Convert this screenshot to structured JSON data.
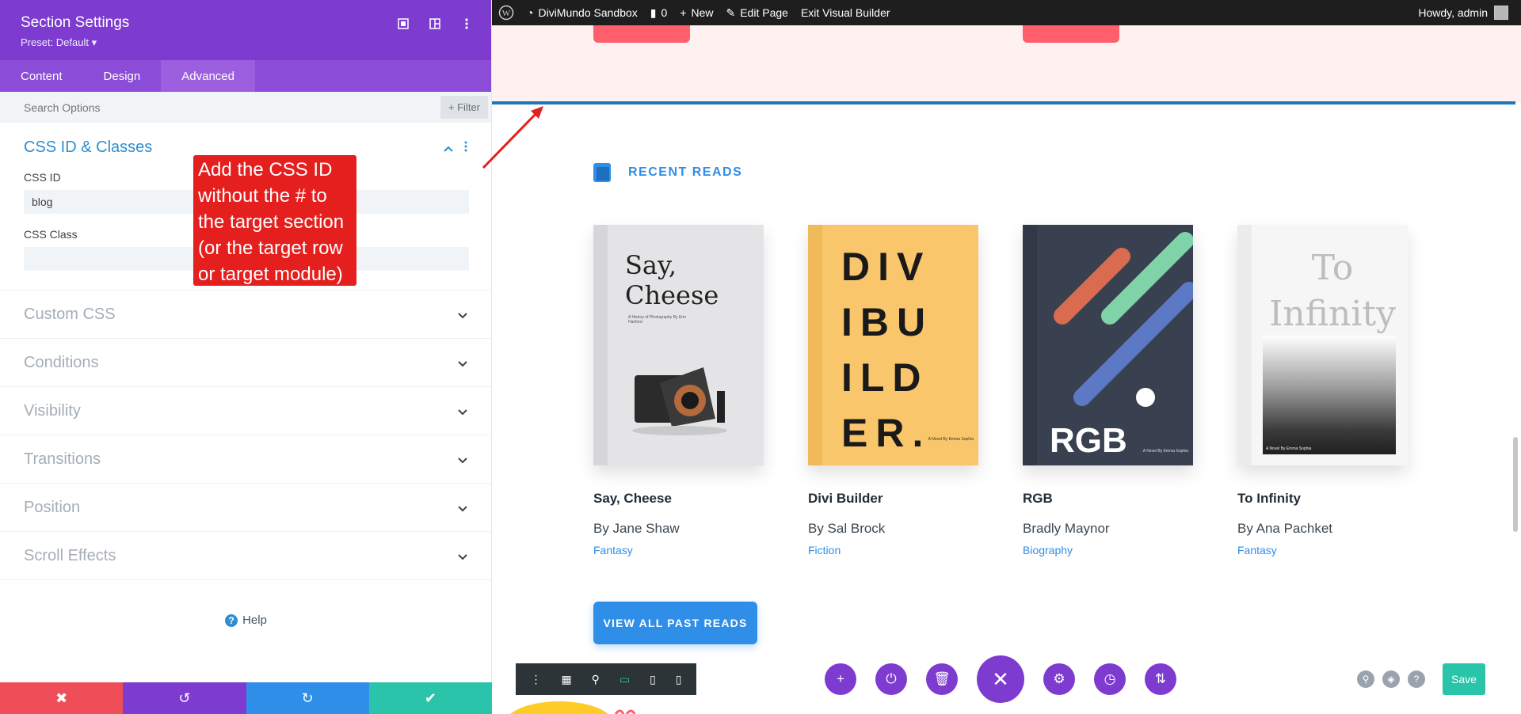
{
  "panel": {
    "title": "Section Settings",
    "preset": "Preset: Default ▾",
    "tabs": [
      "Content",
      "Design",
      "Advanced"
    ],
    "active_tab": "Advanced",
    "search_placeholder": "Search Options",
    "filter_label": "Filter",
    "css_section": {
      "title": "CSS ID & Classes",
      "css_id_label": "CSS ID",
      "css_id_value": "blog",
      "css_class_label": "CSS Class",
      "css_class_value": ""
    },
    "collapsed_sections": [
      "Custom CSS",
      "Conditions",
      "Visibility",
      "Transitions",
      "Position",
      "Scroll Effects"
    ],
    "help_label": "Help",
    "bottom_buttons": [
      "discard",
      "undo",
      "redo",
      "save"
    ],
    "colors": {
      "cancel": "#ef4e58",
      "undo": "#7d3bd0",
      "redo": "#2e8ee8",
      "save": "#29c4a9"
    }
  },
  "annotation": {
    "text": "Add the CSS ID without the # to the target section (or the target row or target module)"
  },
  "admin_bar": {
    "site": "DiviMundo Sandbox",
    "comments": "0",
    "new": "New",
    "edit": "Edit Page",
    "exit": "Exit Visual Builder",
    "greeting": "Howdy, admin"
  },
  "reads": {
    "heading": "RECENT READS",
    "books": [
      {
        "title": "Say, Cheese",
        "author": "By Jane Shaw",
        "genre": "Fantasy",
        "cover_text": "Say, Cheese",
        "cover_small": "A History of Photography By Erin Hanford",
        "cover_color": "#e4e4e6"
      },
      {
        "title": "Divi Builder",
        "author": "By Sal Brock",
        "genre": "Fiction",
        "cover_lines": [
          "DIV",
          "IBU",
          "ILD",
          "ER."
        ],
        "cover_small": "A Novel By Emma Sophia",
        "cover_color": "#f9c66b"
      },
      {
        "title": "RGB",
        "author": "Bradly Maynor",
        "genre": "Biography",
        "cover_text": "RGB",
        "cover_small": "A Novel By Emma Sophia",
        "cover_color": "#394150"
      },
      {
        "title": "To Infinity",
        "author": "By Ana Pachket",
        "genre": "Fantasy",
        "cover_text": "To Infinity",
        "cover_small": "A Novel By Emma Sophia",
        "cover_color": "#f6f6f6"
      }
    ],
    "view_all": "VIEW ALL PAST READS"
  },
  "builder": {
    "save": "Save"
  }
}
